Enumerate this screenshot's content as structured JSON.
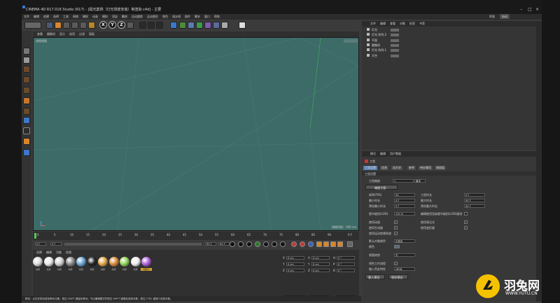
{
  "titlebar": {
    "title": "CINEMA 4D R17.016 Studio (R17) - [极光案例（灯光场景安装）制渲染.c4d] - 主要"
  },
  "menubar": {
    "items": [
      "文件",
      "编辑",
      "创建",
      "选择",
      "工具",
      "网格",
      "捕捉",
      "动画",
      "模拟",
      "渲染",
      "雕刻",
      "运动跟踪",
      "运动图形",
      "角色",
      "流水线",
      "插件",
      "脚本",
      "窗口",
      "帮助"
    ],
    "layout_label": "界面",
    "layout_value": "启动"
  },
  "toolbar": {
    "x": "X",
    "y": "Y",
    "z": "Z"
  },
  "viewport": {
    "menu": [
      "查看",
      "摄像机",
      "显示",
      "选项",
      "过滤",
      "面板"
    ],
    "label": "透视视图",
    "grid_label": "网格间距：100 cm"
  },
  "timeline": {
    "ticks": [
      "0",
      "5",
      "10",
      "15",
      "20",
      "25",
      "30",
      "35",
      "40",
      "45",
      "50",
      "55",
      "60",
      "65",
      "70",
      "75",
      "80",
      "85",
      "90"
    ],
    "frame_end_label": "0 F",
    "start": "0 F",
    "current": "0 F",
    "end": "90 F",
    "end2": "90 F"
  },
  "materials": {
    "menu": [
      "创建",
      "编辑",
      "功能",
      "纹理"
    ],
    "items": [
      {
        "label": "材质",
        "color": "#dcdcdc"
      },
      {
        "label": "材质",
        "color": "#e8e8e8"
      },
      {
        "label": "材质",
        "color": "#d0d0d0"
      },
      {
        "label": "材质",
        "color": "#888888"
      },
      {
        "label": "材质",
        "color": "#6ba7d8"
      },
      {
        "label": "材质",
        "color": "#222222"
      },
      {
        "label": "材质",
        "color": "#e0a84a"
      },
      {
        "label": "材质",
        "color": "#d98a3c"
      },
      {
        "label": "材质",
        "color": "#8fd35a"
      },
      {
        "label": "材质",
        "color": "#eeeeee"
      },
      {
        "label": "材质.6",
        "color": "#b060d8"
      }
    ]
  },
  "coords": {
    "rows": [
      {
        "a": "X",
        "av": "0 cm",
        "b": "X",
        "bv": "0 cm",
        "c": "H",
        "cv": "0 °"
      },
      {
        "a": "Y",
        "av": "0 cm",
        "b": "Y",
        "bv": "0 cm",
        "c": "P",
        "cv": "0 °"
      },
      {
        "a": "Z",
        "av": "0 cm",
        "b": "Z",
        "bv": "0 cm",
        "c": "B",
        "cv": "0 °"
      }
    ],
    "mode1": "世界坐标",
    "mode2": "缩放比例",
    "apply": "应用"
  },
  "objects": {
    "menu": [
      "文件",
      "编辑",
      "查看",
      "对象",
      "标签",
      "书签"
    ],
    "rows": [
      {
        "name": "灯光"
      },
      {
        "name": "灯光 阵列.2"
      },
      {
        "name": "平面"
      },
      {
        "name": "摄像机"
      },
      {
        "name": "灯光 阵列.1"
      },
      {
        "name": "天空"
      }
    ]
  },
  "attributes": {
    "menu": [
      "模式",
      "编辑",
      "用户数据"
    ],
    "object_label": "工程",
    "tabs": [
      "工程设置",
      "信息",
      "动力学",
      "参考",
      "待办事项",
      "帧插值"
    ],
    "section": "工程设置",
    "scale_label": "工程缩放",
    "scale_value": "1",
    "scale_unit": "厘米",
    "scale_btn": "缩放工程...",
    "fps_label": "帧率(FPS)",
    "fps_value": "30",
    "time_label": "工程时长",
    "time_value": "0 F",
    "min_label": "最小时长",
    "min_value": "0 F",
    "max_label": "最大时长",
    "max_value": "90 F",
    "pmin_label": "预览最小时长",
    "pmin_value": "0 F",
    "pmax_label": "预览最大时长",
    "pmax_value": "90 F",
    "lod_label": "细节级别(LOD)",
    "lod_value": "100 %",
    "lod_render_label": "编辑使用渲染细节级别(LOD)级别",
    "anim_label": "使用动画",
    "expr_label": "使用表达式",
    "gen_label": "使用生成器",
    "deform_label": "使用变形器",
    "motion_label": "使用运动剪辑系统",
    "default_color_label": "默认对象颜色",
    "default_color_value": "灰蓝色",
    "color_label": "颜色",
    "view_clip_label": "视图修剪",
    "view_clip_value": "中",
    "linear_label": "线性工作流程",
    "input_color_label": "输入色彩特性",
    "input_color_value": "sRGB",
    "load_btn": "载入预设...",
    "save_btn": "保存预设..."
  },
  "statusbar": {
    "text": "移动：点击并拖动鼠标移动元素。按住 SHIFT 键量化移动；节点编辑模式时按住 SHIFT 键增加选择对象；按住 CTRL 键减少选择对象。"
  },
  "watermark": {
    "brand": "羽兔网",
    "url": "WWW.YUTU.CN"
  }
}
